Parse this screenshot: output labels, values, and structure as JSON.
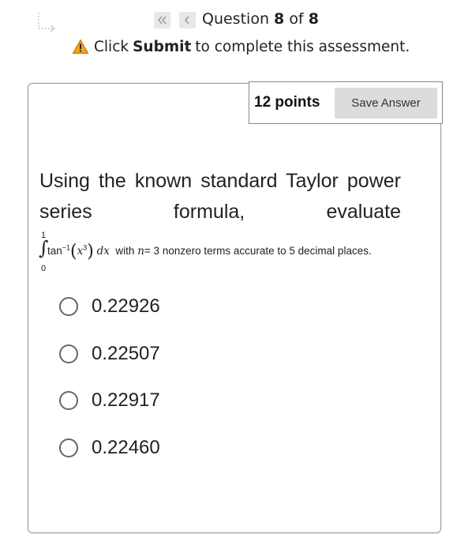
{
  "nav": {
    "first_icon": "double-chevron-left-icon",
    "prev_icon": "chevron-left-icon",
    "question_prefix": "Question",
    "question_number": "8",
    "question_of": "of",
    "question_total": "8"
  },
  "notice": {
    "icon": "warning-icon",
    "prefix": "Click",
    "emphasis": "Submit",
    "suffix": "to complete this assessment."
  },
  "question": {
    "points": "12 points",
    "save_label": "Save Answer",
    "text": "Using the known standard Taylor power series formula, evaluate",
    "formula": {
      "upper_limit": "1",
      "lower_limit": "0",
      "integrand_func": "tan",
      "inverse_exp": "−1",
      "inner_var": "x",
      "inner_exp": "3",
      "differential": "dx",
      "with_text": "with",
      "n_var": "n",
      "n_value": "= 3",
      "tail_text": "nonzero terms accurate to 5 decimal places."
    },
    "options": [
      {
        "label": "0.22926"
      },
      {
        "label": "0.22507"
      },
      {
        "label": "0.22917"
      },
      {
        "label": "0.22460"
      }
    ]
  },
  "colors": {
    "warning_fill": "#f2a21b",
    "button_bg": "#dcdcdc",
    "nav_btn_bg": "#e8e8e8"
  }
}
